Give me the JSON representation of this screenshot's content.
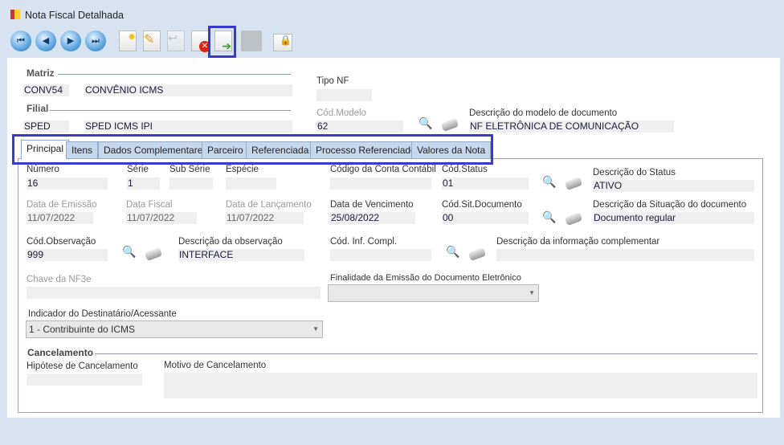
{
  "window": {
    "title": "Nota Fiscal Detalhada"
  },
  "toolbar": {
    "first": "first-record",
    "prev": "previous-record",
    "next": "next-record",
    "last": "last-record"
  },
  "matriz": {
    "label": "Matriz",
    "code": "CONV54",
    "name": "CONVÊNIO ICMS"
  },
  "filial": {
    "label": "Filial",
    "code": "SPED",
    "name": "SPED ICMS IPI"
  },
  "tipo_nf": {
    "label": "Tipo NF",
    "value": ""
  },
  "cod_modelo": {
    "label": "Cód.Modelo",
    "value": "62"
  },
  "desc_modelo": {
    "label": "Descrição do modelo de documento",
    "value": "NF ELETRÔNICA DE COMUNICAÇÃO"
  },
  "tabs": [
    {
      "label": "Principal"
    },
    {
      "label": "Itens"
    },
    {
      "label": "Dados Complementares"
    },
    {
      "label": "Parceiro"
    },
    {
      "label": "Referenciada"
    },
    {
      "label": "Processo Referenciado"
    },
    {
      "label": "Valores da Nota"
    }
  ],
  "fields": {
    "numero": {
      "label": "Número",
      "value": "16"
    },
    "serie": {
      "label": "Série",
      "value": "1"
    },
    "sub_serie": {
      "label": "Sub Série",
      "value": ""
    },
    "especie": {
      "label": "Espécie",
      "value": ""
    },
    "conta_contabil": {
      "label": "Código da Conta Contábil",
      "value": ""
    },
    "cod_status": {
      "label": "Cód.Status",
      "value": "01"
    },
    "desc_status": {
      "label": "Descrição do Status",
      "value": "ATIVO"
    },
    "data_emissao": {
      "label": "Data de Emissão",
      "value": "11/07/2022"
    },
    "data_fiscal": {
      "label": "Data Fiscal",
      "value": "11/07/2022"
    },
    "data_lancamento": {
      "label": "Data de Lançamento",
      "value": "11/07/2022"
    },
    "data_vencimento": {
      "label": "Data de Vencimento",
      "value": "25/08/2022"
    },
    "cod_sit": {
      "label": "Cód.Sit.Documento",
      "value": "00"
    },
    "desc_sit": {
      "label": "Descrição da Situação do documento",
      "value": "Documento regular"
    },
    "cod_obs": {
      "label": "Cód.Observação",
      "value": "999"
    },
    "desc_obs": {
      "label": "Descrição da observação",
      "value": "INTERFACE"
    },
    "cod_inf": {
      "label": "Cód. Inf. Compl.",
      "value": ""
    },
    "desc_inf": {
      "label": "Descrição da informação complementar",
      "value": ""
    },
    "chave": {
      "label": "Chave da NF3e",
      "value": ""
    },
    "finalidade": {
      "label": "Finalidade da Emissão do Documento Eletrônico",
      "value": ""
    },
    "indicador": {
      "label": "Indicador do Destinatário/Acessante",
      "value": "1 - Contribuinte do ICMS"
    }
  },
  "cancelamento": {
    "label": "Cancelamento",
    "hipotese": {
      "label": "Hipótese de Cancelamento",
      "value": ""
    },
    "motivo": {
      "label": "Motivo de Cancelamento",
      "value": ""
    }
  }
}
